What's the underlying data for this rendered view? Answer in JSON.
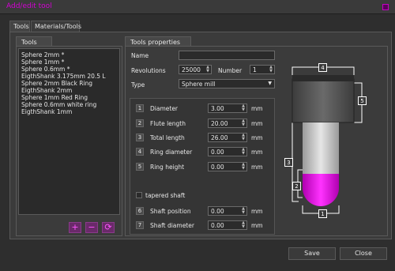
{
  "window": {
    "title": "Add/edit tool"
  },
  "tabs": [
    {
      "label": "Tools",
      "active": true
    },
    {
      "label": "Materials/Tools",
      "active": false
    }
  ],
  "tools_panel": {
    "header": "Tools",
    "items": [
      "Sphere 2mm *",
      "Sphere 1mm *",
      "Sphere 0.6mm *",
      "EigthShank 3.175mm 20.5 L",
      "Sphere 2mm Black Ring",
      "EigthShank 2mm",
      "Sphere 1mm Red Ring",
      "Sphere 0.6mm white ring",
      "EigthShank 1mm"
    ],
    "buttons": [
      {
        "symbol": "+",
        "icon": "add-icon"
      },
      {
        "symbol": "−",
        "icon": "remove-icon"
      },
      {
        "symbol": "⟳",
        "icon": "refresh-icon"
      }
    ]
  },
  "properties": {
    "header": "Tools properties",
    "name_label": "Name",
    "name_value": "",
    "revolutions_label": "Revolutions",
    "revolutions_value": "25000",
    "number_label": "Number",
    "number_value": "1",
    "type_label": "Type",
    "type_value": "Sphere mill",
    "fields": [
      {
        "num": "1",
        "label": "Diameter",
        "value": "3.00",
        "unit": "mm"
      },
      {
        "num": "2",
        "label": "Flute length",
        "value": "20.00",
        "unit": "mm"
      },
      {
        "num": "3",
        "label": "Total length",
        "value": "26.00",
        "unit": "mm"
      },
      {
        "num": "4",
        "label": "Ring diameter",
        "value": "0.00",
        "unit": "mm"
      },
      {
        "num": "5",
        "label": "Ring height",
        "value": "0.00",
        "unit": "mm"
      }
    ],
    "tapered_label": "tapered shaft",
    "shaft_fields": [
      {
        "num": "6",
        "label": "Shaft position",
        "value": "0.00",
        "unit": "mm"
      },
      {
        "num": "7",
        "label": "Shaft diameter",
        "value": "0.00",
        "unit": "mm"
      }
    ]
  },
  "diagram": {
    "labels": [
      "4",
      "5",
      "3",
      "2",
      "1"
    ],
    "accent": "#d400d4"
  },
  "footer": {
    "save": "Save",
    "close": "Close"
  },
  "colors": {
    "accent": "#d400d4",
    "background": "#2e2e2e"
  }
}
